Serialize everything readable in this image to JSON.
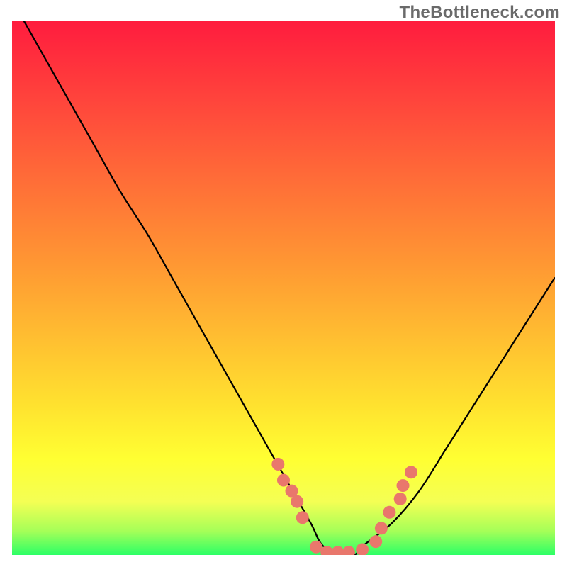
{
  "watermark": "TheBottleneck.com",
  "chart_data": {
    "type": "line",
    "title": "",
    "xlabel": "",
    "ylabel": "",
    "series": [
      {
        "name": "curve",
        "x": [
          0.0,
          0.05,
          0.1,
          0.15,
          0.2,
          0.25,
          0.3,
          0.35,
          0.4,
          0.45,
          0.5,
          0.55,
          0.57,
          0.6,
          0.63,
          0.65,
          0.7,
          0.75,
          0.8,
          0.85,
          0.9,
          0.95,
          1.0
        ],
        "y": [
          104,
          95,
          86,
          77,
          68,
          60,
          51,
          42,
          33,
          24,
          15,
          6,
          2,
          0,
          0,
          2,
          6,
          12,
          20,
          28,
          36,
          44,
          52
        ]
      },
      {
        "name": "markers",
        "x": [
          0.49,
          0.5,
          0.515,
          0.525,
          0.535,
          0.56,
          0.58,
          0.6,
          0.62,
          0.645,
          0.67,
          0.68,
          0.695,
          0.715,
          0.72,
          0.735
        ],
        "y": [
          17,
          14,
          12,
          10,
          7,
          1.5,
          0.5,
          0.5,
          0.5,
          1,
          2.5,
          5,
          8,
          10.5,
          13,
          15.5
        ]
      }
    ],
    "xlim": [
      0,
      1
    ],
    "ylim": [
      0,
      100
    ]
  },
  "colors": {
    "gradient_stops": [
      "#ff1c3e",
      "#ff4d3b",
      "#ff9633",
      "#ffe22f",
      "#ffff32",
      "#f4ff54",
      "#a6ff58",
      "#2cff66"
    ],
    "marker": "#e9776c"
  }
}
